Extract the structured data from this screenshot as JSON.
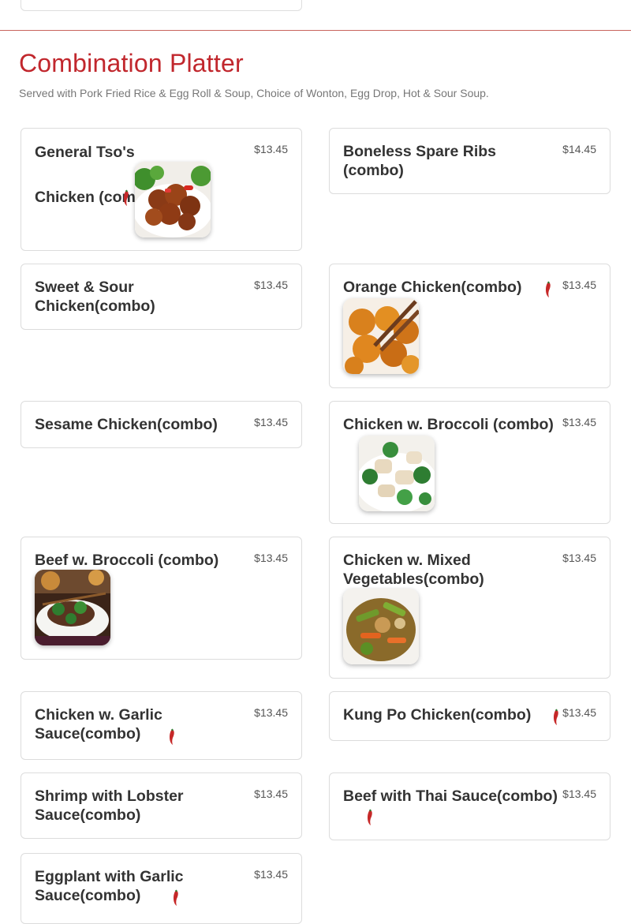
{
  "section": {
    "title": "Combination Platter",
    "subtitle": "Served with Pork Fried Rice & Egg Roll & Soup, Choice of Wonton, Egg Drop, Hot & Sour Soup."
  },
  "items": [
    {
      "name": "General Tso's Chicken (combo)",
      "price": "$13.45",
      "spicy": true,
      "image": "general-tso-chicken-photo"
    },
    {
      "name": "Boneless Spare Ribs (combo)",
      "price": "$14.45",
      "spicy": false
    },
    {
      "name": "Sweet & Sour Chicken(combo)",
      "price": "$13.45",
      "spicy": false
    },
    {
      "name": "Orange Chicken(combo)",
      "price": "$13.45",
      "spicy": true,
      "image": "orange-chicken-photo"
    },
    {
      "name": "Sesame Chicken(combo)",
      "price": "$13.45",
      "spicy": false
    },
    {
      "name": "Chicken w. Broccoli (combo)",
      "price": "$13.45",
      "spicy": false,
      "image": "chicken-broccoli-photo"
    },
    {
      "name": "Beef w. Broccoli (combo)",
      "price": "$13.45",
      "spicy": false,
      "image": "beef-broccoli-photo"
    },
    {
      "name": "Chicken w. Mixed Vegetables(combo)",
      "price": "$13.45",
      "spicy": false,
      "image": "chicken-mixed-vegetables-photo"
    },
    {
      "name": "Chicken w. Garlic Sauce(combo)",
      "price": "$13.45",
      "spicy": true
    },
    {
      "name": "Kung Po Chicken(combo)",
      "price": "$13.45",
      "spicy": true
    },
    {
      "name": "Shrimp with Lobster Sauce(combo)",
      "price": "$13.45",
      "spicy": false
    },
    {
      "name": "Beef with Thai Sauce(combo)",
      "price": "$13.45",
      "spicy": true
    },
    {
      "name": "Eggplant with Garlic Sauce(combo)",
      "price": "$13.45",
      "spicy": true
    }
  ],
  "colors": {
    "title": "#c1272d",
    "divider": "#c8645e",
    "chili": "#c62828",
    "card_border": "#dcdcdc"
  },
  "icons": {
    "spicy": "chili-pepper-icon"
  }
}
